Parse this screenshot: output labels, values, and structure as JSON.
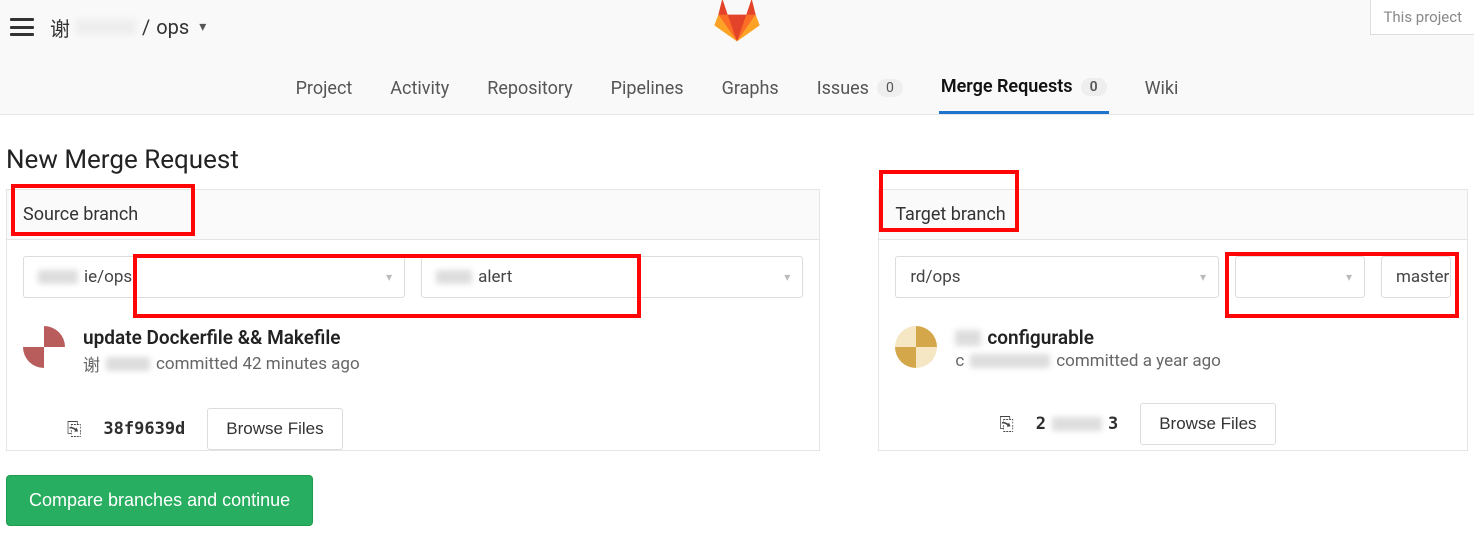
{
  "breadcrumb": {
    "user_prefix": "谢",
    "separator": "/",
    "project": "ops"
  },
  "top_right_label": "This project",
  "tabs": {
    "project": "Project",
    "activity": "Activity",
    "repository": "Repository",
    "pipelines": "Pipelines",
    "graphs": "Graphs",
    "issues": "Issues",
    "issues_count": "0",
    "merge_requests": "Merge Requests",
    "mr_count": "0",
    "wiki": "Wiki"
  },
  "page_title": "New Merge Request",
  "source": {
    "label": "Source branch",
    "project_suffix": "ie/ops",
    "branch_suffix": "alert",
    "commit_title": "update Dockerfile && Makefile",
    "committer_prefix": "谢",
    "committed_text": "committed 42 minutes ago",
    "sha": "38f9639d",
    "browse": "Browse Files"
  },
  "target": {
    "label": "Target branch",
    "project": "rd/ops",
    "branch": "master",
    "commit_title_suffix": "configurable",
    "committed_text": "committed a year ago",
    "sha_suffix": "3",
    "browse": "Browse Files"
  },
  "compare_button": "Compare branches and continue"
}
